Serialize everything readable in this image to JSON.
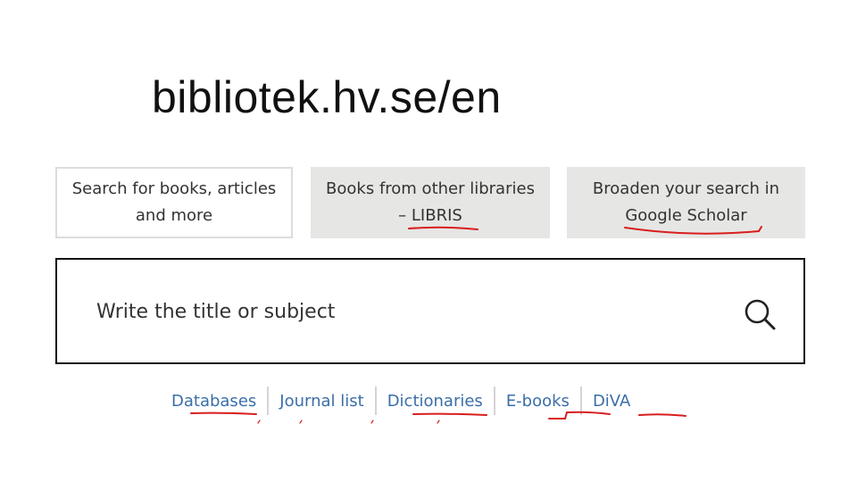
{
  "title": "bibliotek.hv.se/en",
  "tabs": [
    {
      "line1": "Search for books, articles",
      "line2": "and more"
    },
    {
      "line1": "Books from other libraries",
      "line2": "– LIBRIS"
    },
    {
      "line1": "Broaden your search in",
      "line2": "Google Scholar"
    }
  ],
  "search": {
    "placeholder": "Write the title or subject",
    "button_icon": "search-icon"
  },
  "quick_links": [
    "Databases",
    "Journal list",
    "Dictionaries",
    "E-books",
    "DiVA"
  ],
  "colors": {
    "link": "#3b6ea8",
    "tab_inactive_bg": "#e6e6e4",
    "annotation_ink": "#d81e1e"
  }
}
